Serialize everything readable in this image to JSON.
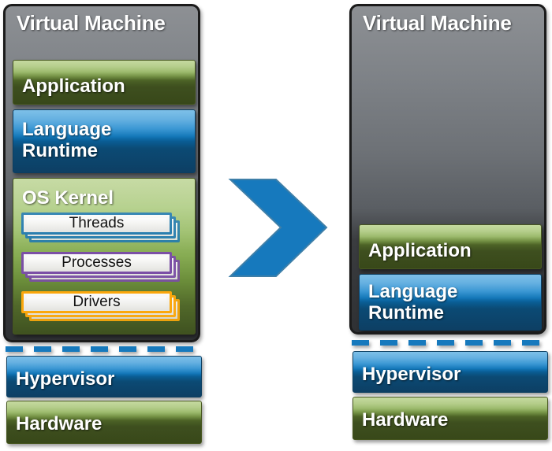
{
  "diagram": {
    "title": "Virtual Machine architecture: traditional OS stack versus library OS / unikernel stack",
    "accent_blue": "#1679bd",
    "accent_green": "#6f8e3d",
    "vm_gray": "#7e8287"
  },
  "left_panel": {
    "vm_title": "Virtual Machine",
    "layers": [
      {
        "label": "Application",
        "style": "green"
      },
      {
        "label": "Language\nRuntime",
        "line1": "Language",
        "line2": "Runtime",
        "style": "blue"
      },
      {
        "label": "OS Kernel",
        "style": "kernel-green"
      }
    ],
    "kernel_items": [
      {
        "label": "Threads",
        "accent": "#1f78ab"
      },
      {
        "label": "Processes",
        "accent": "#7b4fa6"
      },
      {
        "label": "Drivers",
        "accent": "#fba70c"
      }
    ],
    "divider": "dashed-line",
    "base_layers": [
      {
        "label": "Hypervisor",
        "style": "blue"
      },
      {
        "label": "Hardware",
        "style": "green"
      }
    ]
  },
  "right_panel": {
    "vm_title": "Virtual Machine",
    "layers": [
      {
        "label": "Application",
        "style": "green"
      },
      {
        "label": "Language\nRuntime",
        "line1": "Language",
        "line2": "Runtime",
        "style": "blue"
      }
    ],
    "divider": "dashed-line",
    "base_layers": [
      {
        "label": "Hypervisor",
        "style": "blue"
      },
      {
        "label": "Hardware",
        "style": "green"
      }
    ]
  },
  "arrow": {
    "name": "chevron-right-arrow",
    "color": "#1679bd",
    "direction": "right"
  }
}
